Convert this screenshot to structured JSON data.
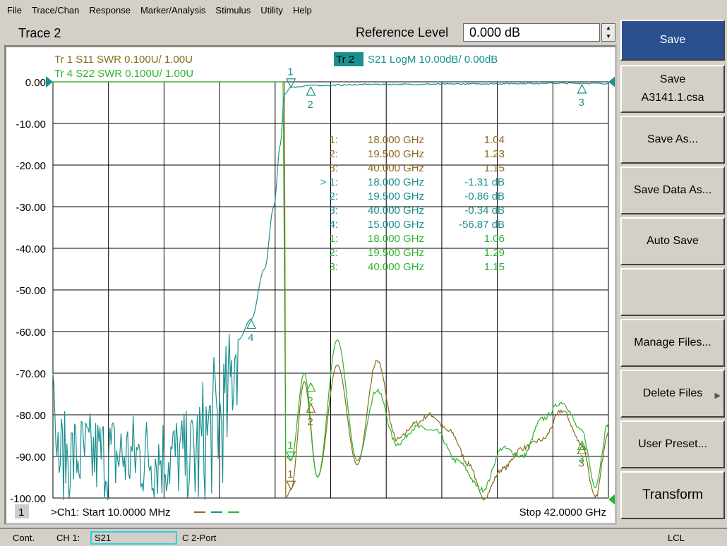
{
  "menu": [
    "File",
    "Trace/Chan",
    "Response",
    "Marker/Analysis",
    "Stimulus",
    "Utility",
    "Help"
  ],
  "title": {
    "trace": "Trace 2",
    "ref_label": "Reference Level",
    "ref_value": "0.000 dB"
  },
  "traces_header": [
    {
      "label": "Tr  1   S11 SWR 0.100U/  1.00U",
      "color": "#8b6a1a"
    },
    {
      "label": "Tr  4   S22 SWR 0.100U/  1.00U",
      "color": "#2cb52c"
    },
    {
      "tr": "Tr  2",
      "label": "S21 LogM 10.00dB/  0.00dB",
      "color": "#1a9090"
    }
  ],
  "y_ticks": [
    "0.00",
    "-10.00",
    "-20.00",
    "-30.00",
    "-40.00",
    "-50.00",
    "-60.00",
    "-70.00",
    "-80.00",
    "-90.00",
    "-100.00"
  ],
  "marker_table": [
    {
      "id": "1:",
      "freq": "18.000 GHz",
      "val": "1.04",
      "trace": "s11"
    },
    {
      "id": "2:",
      "freq": "19.500 GHz",
      "val": "1.23",
      "trace": "s11"
    },
    {
      "id": "3:",
      "freq": "40.000 GHz",
      "val": "1.15",
      "trace": "s11"
    },
    {
      "id": "> 1:",
      "freq": "18.000 GHz",
      "val": "-1.31 dB",
      "trace": "s21"
    },
    {
      "id": "2:",
      "freq": "19.500 GHz",
      "val": "-0.86 dB",
      "trace": "s21"
    },
    {
      "id": "3:",
      "freq": "40.000 GHz",
      "val": "-0.34 dB",
      "trace": "s21"
    },
    {
      "id": "4:",
      "freq": "15.000 GHz",
      "val": "-56.87 dB",
      "trace": "s21"
    },
    {
      "id": "1:",
      "freq": "18.000 GHz",
      "val": "1.06",
      "trace": "s22"
    },
    {
      "id": "2:",
      "freq": "19.500 GHz",
      "val": "1.29",
      "trace": "s22"
    },
    {
      "id": "3:",
      "freq": "40.000 GHz",
      "val": "1.15",
      "trace": "s22"
    }
  ],
  "footer": {
    "channel": "1",
    "start": ">Ch1: Start  10.0000 MHz",
    "stop": "Stop  42.0000 GHz"
  },
  "chart_data": {
    "type": "line",
    "x_unit": "GHz",
    "xlim": [
      0.01,
      42
    ],
    "ylim": [
      -100,
      0
    ],
    "y_unit": "dB",
    "grid": true,
    "series": [
      {
        "name": "S11",
        "color": "#8b6a1a",
        "x": [
          0,
          17.5,
          17.6,
          18,
          19,
          20,
          21.5,
          23,
          24.5,
          26,
          27.5,
          28.5,
          30,
          31.5,
          32.5,
          34,
          35.5,
          37,
          38.5,
          40,
          41,
          42
        ],
        "y": [
          0,
          0,
          -100,
          -98,
          -72,
          -95,
          -68,
          -92,
          -67,
          -86,
          -82,
          -80,
          -84,
          -92,
          -100,
          -93,
          -88,
          -86,
          -79,
          -87,
          -100,
          -84
        ]
      },
      {
        "name": "S22",
        "color": "#2cb52c",
        "x": [
          0,
          17.4,
          17.6,
          18,
          19,
          20,
          21.5,
          23,
          24.5,
          26,
          27.5,
          29,
          30.5,
          32.5,
          34,
          35.5,
          37,
          38.5,
          40,
          41,
          42
        ],
        "y": [
          0,
          0,
          -90,
          -91,
          -70,
          -95,
          -62,
          -91,
          -74,
          -87,
          -83,
          -84,
          -91,
          -98,
          -88,
          -90,
          -81,
          -77,
          -84,
          -97,
          -82
        ]
      },
      {
        "name": "S21",
        "color": "#1a9090",
        "x": [
          0,
          0.3,
          10.5,
          13,
          14,
          15,
          16,
          16.7,
          17.2,
          17.5,
          18,
          19.5,
          25,
          40,
          42
        ],
        "y": [
          -70,
          -90,
          -90,
          -80,
          -62,
          -57,
          -45,
          -30,
          -15,
          -3,
          -1.31,
          -0.86,
          -0.6,
          -0.34,
          -0.4
        ]
      }
    ],
    "markers": [
      {
        "trace": "S21",
        "n": "1",
        "x": 18,
        "y": -1.31,
        "dir": "down"
      },
      {
        "trace": "S21",
        "n": "2",
        "x": 19.5,
        "y": -0.86,
        "dir": "up"
      },
      {
        "trace": "S21",
        "n": "3",
        "x": 40,
        "y": -0.34,
        "dir": "up"
      },
      {
        "trace": "S21",
        "n": "4",
        "x": 15,
        "y": -56.87,
        "dir": "up"
      },
      {
        "trace": "S11",
        "n": "1",
        "x": 18,
        "y": -98,
        "dir": "down"
      },
      {
        "trace": "S11",
        "n": "2",
        "x": 19.5,
        "y": -77,
        "dir": "up"
      },
      {
        "trace": "S11",
        "n": "3",
        "x": 40,
        "y": -87,
        "dir": "up"
      },
      {
        "trace": "S22",
        "n": "1",
        "x": 18,
        "y": -91,
        "dir": "down"
      },
      {
        "trace": "S22",
        "n": "2",
        "x": 19.5,
        "y": -72,
        "dir": "up"
      },
      {
        "trace": "S22",
        "n": "3",
        "x": 40,
        "y": -86,
        "dir": "up"
      }
    ]
  },
  "softkeys": [
    "Save",
    "Save\nA3141.1.csa",
    "Save As...",
    "Save Data As...",
    "Auto Save",
    "",
    "Manage Files...",
    "Delete Files",
    "User Preset...",
    "Transform"
  ],
  "status": {
    "mode": "Cont.",
    "ch": "CH 1:",
    "param": "S21",
    "cal": "C  2-Port",
    "remote": "LCL"
  }
}
